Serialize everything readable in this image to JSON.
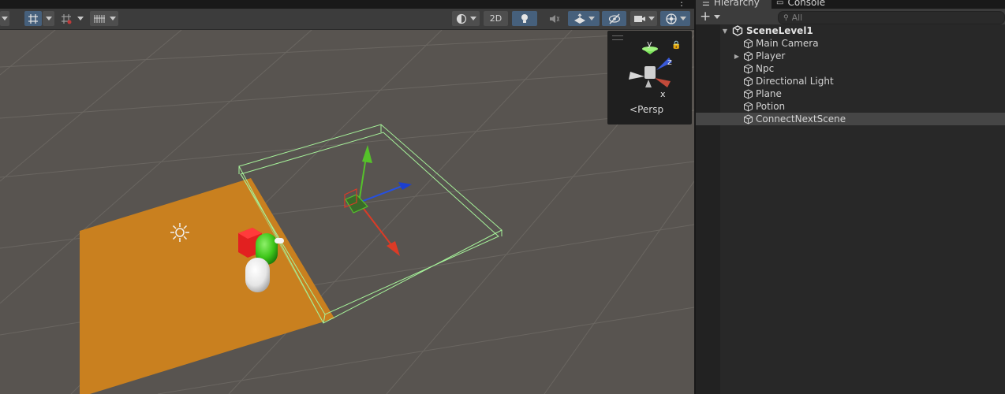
{
  "scene_toolbar": {
    "mode_2d_label": "2D",
    "buttons": [
      "grid-snap-icon",
      "increment-snap-icon",
      "grid-visibility-icon",
      "shading-mode-icon",
      "lighting-icon",
      "audio-icon",
      "effects-icon",
      "scene-visibility-icon",
      "camera-icon",
      "gizmos-icon"
    ]
  },
  "view_gizmo": {
    "axis_y": "y",
    "axis_z": "z",
    "axis_x": "x",
    "projection_label": "Persp"
  },
  "hierarchy": {
    "tabs": [
      "Hierarchy",
      "Console"
    ],
    "search_placeholder": "All",
    "scene_name": "SceneLevel1",
    "items": [
      {
        "label": "Main Camera",
        "expandable": false,
        "selected": false
      },
      {
        "label": "Player",
        "expandable": true,
        "selected": false
      },
      {
        "label": "Npc",
        "expandable": false,
        "selected": false
      },
      {
        "label": "Directional Light",
        "expandable": false,
        "selected": false
      },
      {
        "label": "Plane",
        "expandable": false,
        "selected": false
      },
      {
        "label": "Potion",
        "expandable": false,
        "selected": false
      },
      {
        "label": "ConnectNextScene",
        "expandable": false,
        "selected": true
      }
    ]
  },
  "colors": {
    "plane": "#c9801f",
    "viewport_bg": "#585450",
    "trigger_wireframe": "#a6f29a",
    "axis_x": "#db3b26",
    "axis_y": "#55c22a",
    "axis_z": "#2650e0",
    "selection": "#464646"
  }
}
